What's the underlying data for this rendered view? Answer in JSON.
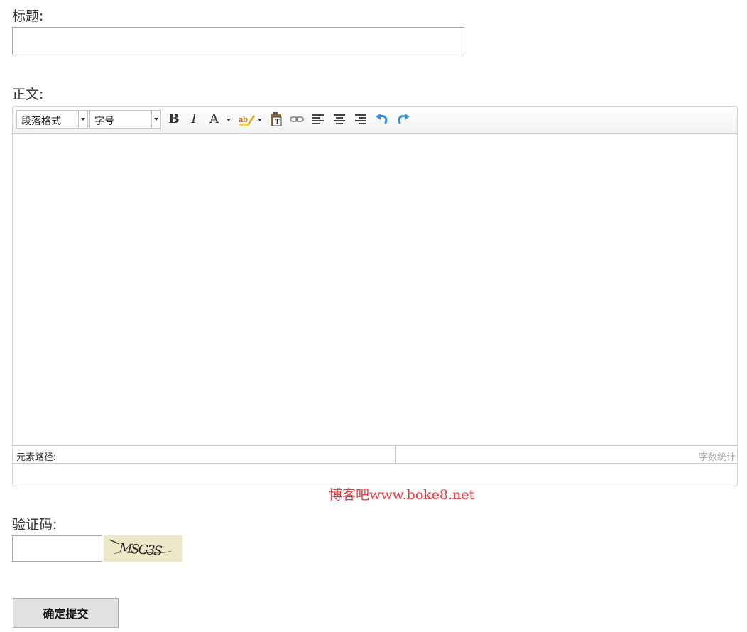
{
  "form": {
    "title_label": "标题:",
    "title_value": "",
    "body_label": "正文:",
    "captcha_label": "验证码:",
    "captcha_value": "",
    "captcha_text": "MSG3S",
    "submit_label": "确定提交"
  },
  "editor": {
    "paragraph_format": "段落格式",
    "font_size": "字号",
    "bold": "B",
    "italic": "I",
    "font_color": "A",
    "status_path_label": "元素路径:",
    "word_count_label": "字数统计",
    "icons": [
      "bold-icon",
      "italic-icon",
      "font-color-icon",
      "highlight-icon",
      "paste-text-icon",
      "link-icon",
      "align-left-icon",
      "align-center-icon",
      "align-right-icon",
      "undo-icon",
      "redo-icon"
    ]
  },
  "watermark": "博客吧www.boke8.net",
  "colors": {
    "watermark": "#e83a3a",
    "undo_redo": "#3a8fd6",
    "captcha_bg": "#ece8c8"
  }
}
